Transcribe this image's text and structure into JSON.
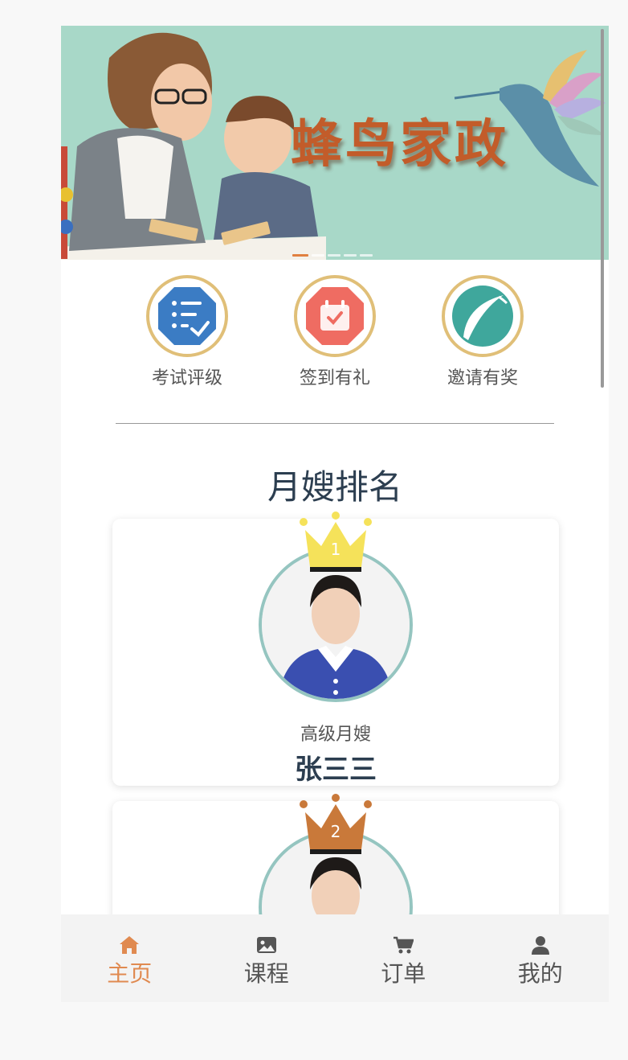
{
  "banner": {
    "title": "蜂鸟家政",
    "dot_count": 5,
    "active_dot": 0
  },
  "actions": [
    {
      "label": "考试评级",
      "icon": "checklist-icon",
      "color": "#3b7cc4"
    },
    {
      "label": "签到有礼",
      "icon": "calendar-check-icon",
      "color": "#ef6c62"
    },
    {
      "label": "邀请有奖",
      "icon": "leaf-icon",
      "color": "#3fa79c"
    }
  ],
  "section_title": "月嫂排名",
  "ranking": [
    {
      "rank": "1",
      "role": "高级月嫂",
      "name": "张三三",
      "crown_color": "#f5e25a"
    },
    {
      "rank": "2",
      "role": "",
      "name": "",
      "crown_color": "#c9793a"
    }
  ],
  "tabbar": {
    "active": 0,
    "tabs": [
      {
        "label": "主页",
        "icon": "home-icon"
      },
      {
        "label": "课程",
        "icon": "image-icon"
      },
      {
        "label": "订单",
        "icon": "cart-icon"
      },
      {
        "label": "我的",
        "icon": "user-icon"
      }
    ]
  },
  "colors": {
    "accent": "#e08a50",
    "banner_bg": "#a8d8c8",
    "ring": "#e0bf78",
    "title_text": "#2c3e50"
  }
}
